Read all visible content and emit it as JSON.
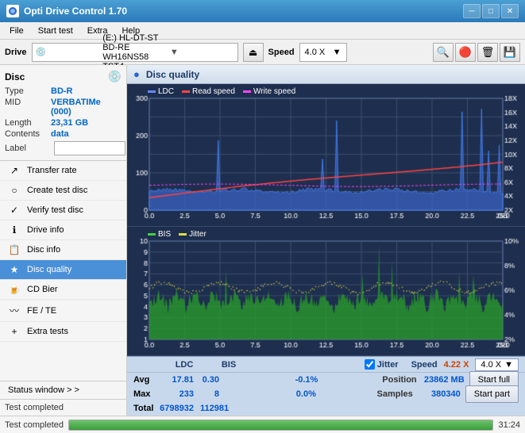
{
  "app": {
    "title": "Opti Drive Control 1.70",
    "icon": "●"
  },
  "titlebar": {
    "minimize": "─",
    "maximize": "□",
    "close": "✕"
  },
  "menubar": {
    "items": [
      "File",
      "Start test",
      "Extra",
      "Help"
    ]
  },
  "drivebar": {
    "drive_label": "Drive",
    "drive_value": "(E:)  HL-DT-ST BD-RE  WH16NS58 TST4",
    "speed_label": "Speed",
    "speed_value": "4.0 X",
    "eject_icon": "⏏"
  },
  "disc_panel": {
    "title": "Disc",
    "type_label": "Type",
    "type_value": "BD-R",
    "mid_label": "MID",
    "mid_value": "VERBATIMe (000)",
    "length_label": "Length",
    "length_value": "23,31 GB",
    "contents_label": "Contents",
    "contents_value": "data",
    "label_label": "Label",
    "label_placeholder": "",
    "label_btn": "⚙"
  },
  "nav": {
    "items": [
      {
        "id": "transfer-rate",
        "label": "Transfer rate",
        "icon": "↗"
      },
      {
        "id": "create-test-disc",
        "label": "Create test disc",
        "icon": "💿"
      },
      {
        "id": "verify-test-disc",
        "label": "Verify test disc",
        "icon": "✓"
      },
      {
        "id": "drive-info",
        "label": "Drive info",
        "icon": "ℹ"
      },
      {
        "id": "disc-info",
        "label": "Disc info",
        "icon": "📄"
      },
      {
        "id": "disc-quality",
        "label": "Disc quality",
        "icon": "★",
        "active": true
      },
      {
        "id": "cd-bier",
        "label": "CD Bier",
        "icon": "🍺"
      },
      {
        "id": "fe-te",
        "label": "FE / TE",
        "icon": "〰"
      },
      {
        "id": "extra-tests",
        "label": "Extra tests",
        "icon": "+"
      }
    ],
    "status_window": "Status window  > >"
  },
  "disc_quality": {
    "title": "Disc quality",
    "icon": "●"
  },
  "chart1": {
    "legend": [
      {
        "label": "LDC",
        "color": "#4488ff"
      },
      {
        "label": "Read speed",
        "color": "#ff6666"
      },
      {
        "label": "Write speed",
        "color": "#ff44ff"
      }
    ],
    "y_left": [
      "300",
      "200",
      "100",
      "0"
    ],
    "y_right": [
      "18X",
      "16X",
      "14X",
      "12X",
      "10X",
      "8X",
      "6X",
      "4X",
      "2X"
    ],
    "x": [
      "0.0",
      "2.5",
      "5.0",
      "7.5",
      "10.0",
      "12.5",
      "15.0",
      "17.5",
      "20.0",
      "22.5",
      "25.0 GB"
    ]
  },
  "chart2": {
    "legend": [
      {
        "label": "BIS",
        "color": "#44dd44"
      },
      {
        "label": "Jitter",
        "color": "#dddd44"
      }
    ],
    "y_left": [
      "10",
      "9",
      "8",
      "7",
      "6",
      "5",
      "4",
      "3",
      "2",
      "1"
    ],
    "y_right": [
      "10%",
      "8%",
      "6%",
      "4%",
      "2%"
    ],
    "x": [
      "0.0",
      "2.5",
      "5.0",
      "7.5",
      "10.0",
      "12.5",
      "15.0",
      "17.5",
      "20.0",
      "22.5",
      "25.0 GB"
    ]
  },
  "stats": {
    "headers": [
      "",
      "LDC",
      "BIS",
      "",
      "Jitter",
      "Speed",
      ""
    ],
    "avg_label": "Avg",
    "avg_ldc": "17.81",
    "avg_bis": "0.30",
    "avg_jitter": "-0.1%",
    "max_label": "Max",
    "max_ldc": "233",
    "max_bis": "8",
    "max_jitter": "0.0%",
    "total_label": "Total",
    "total_ldc": "6798932",
    "total_bis": "112981",
    "speed_label": "Speed",
    "speed_value": "4.22 X",
    "speed_select": "4.0 X",
    "position_label": "Position",
    "position_value": "23862 MB",
    "samples_label": "Samples",
    "samples_value": "380340",
    "jitter_checked": true,
    "jitter_label": "Jitter"
  },
  "buttons": {
    "start_full": "Start full",
    "start_part": "Start part"
  },
  "status_bar": {
    "text": "Test completed",
    "progress": 100,
    "time": "31:24"
  }
}
